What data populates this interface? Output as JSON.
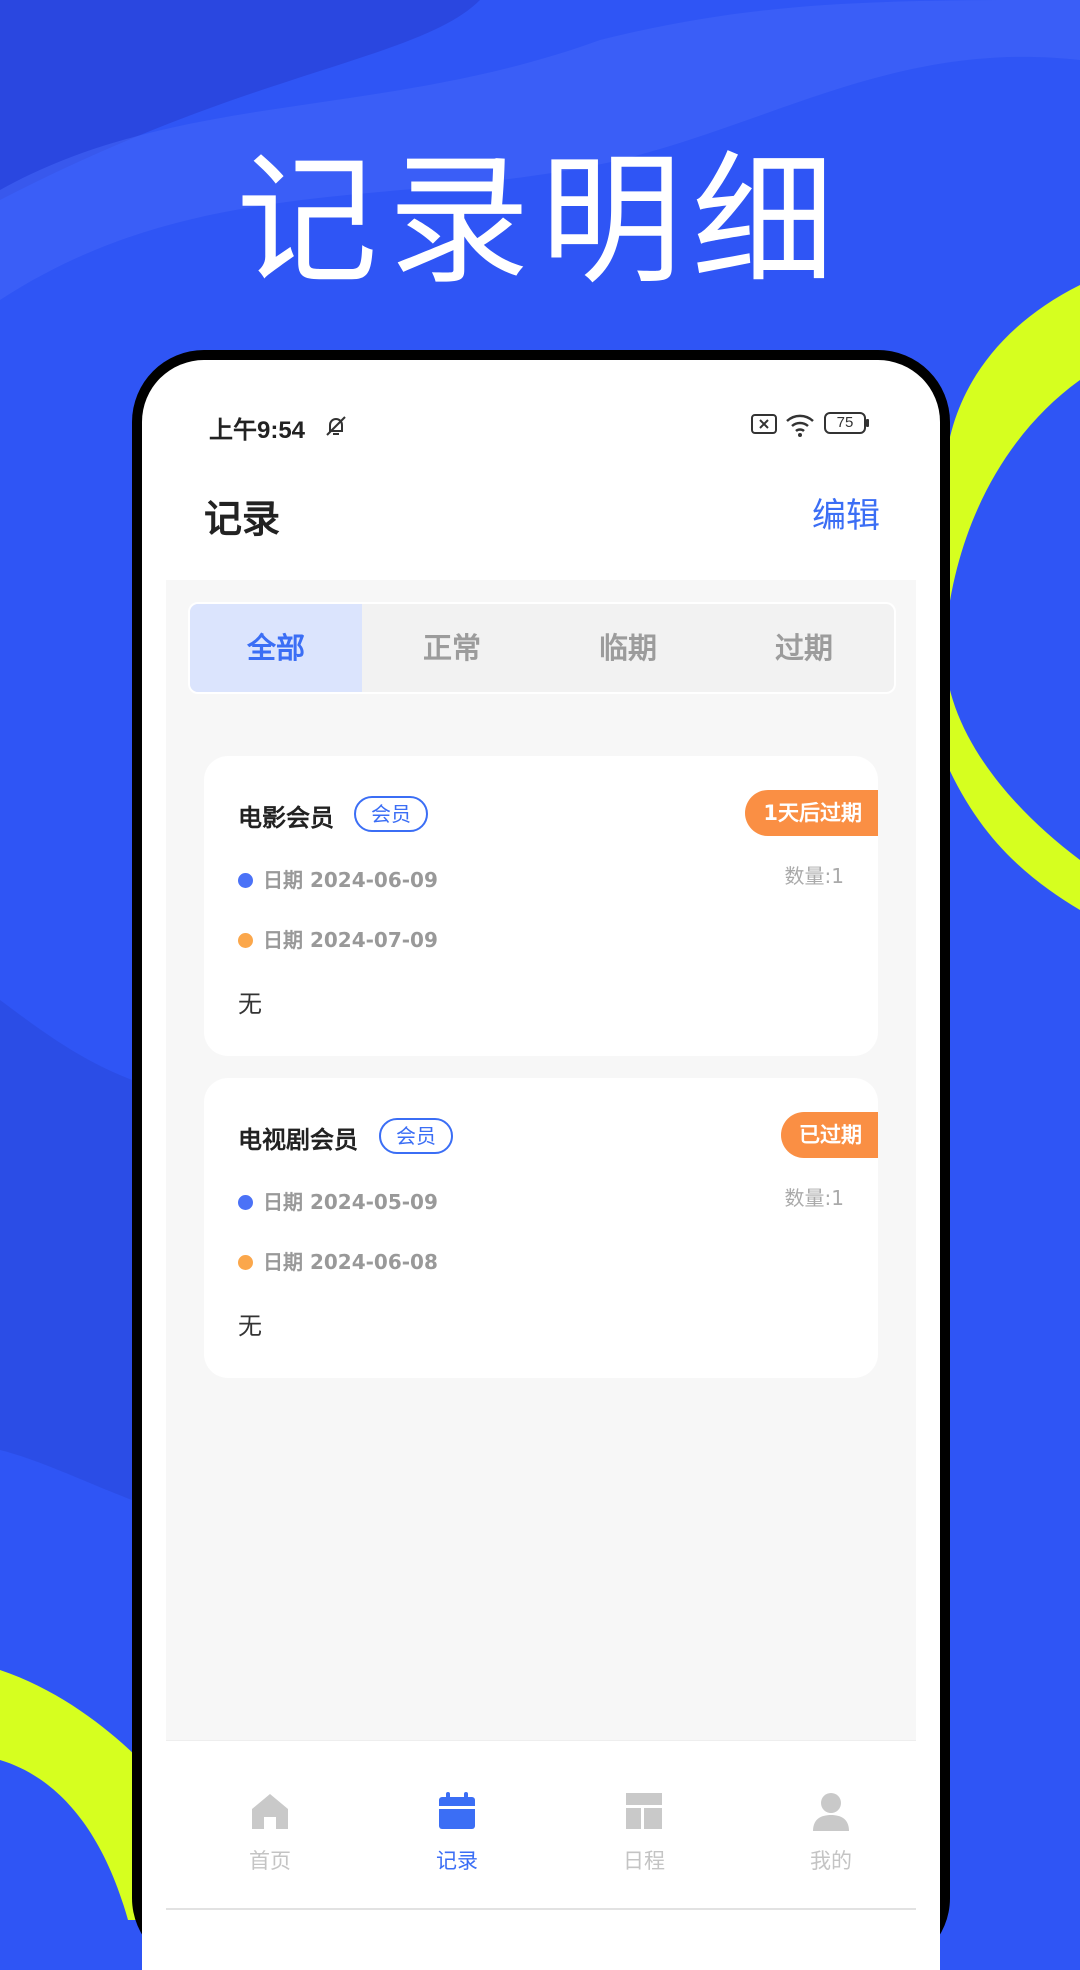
{
  "hero": {
    "title": "记录明细"
  },
  "status_bar": {
    "time": "上午9:54",
    "battery": "75"
  },
  "header": {
    "title": "记录",
    "edit_label": "编辑"
  },
  "tabs": [
    {
      "label": "全部",
      "active": true
    },
    {
      "label": "正常",
      "active": false
    },
    {
      "label": "临期",
      "active": false
    },
    {
      "label": "过期",
      "active": false
    }
  ],
  "records": [
    {
      "title": "电影会员",
      "tag": "会员",
      "badge": "1天后过期",
      "quantity": "数量:1",
      "start_date": "日期 2024-06-09",
      "end_date": "日期 2024-07-09",
      "note": "无"
    },
    {
      "title": "电视剧会员",
      "tag": "会员",
      "badge": "已过期",
      "quantity": "数量:1",
      "start_date": "日期 2024-05-09",
      "end_date": "日期 2024-06-08",
      "note": "无"
    }
  ],
  "bottom_nav": [
    {
      "label": "首页",
      "icon": "home-icon",
      "active": false
    },
    {
      "label": "记录",
      "icon": "calendar-icon",
      "active": true
    },
    {
      "label": "日程",
      "icon": "dashboard-icon",
      "active": false
    },
    {
      "label": "我的",
      "icon": "user-icon",
      "active": false
    }
  ],
  "colors": {
    "background": "#2f55f5",
    "accent": "#3b6ef5",
    "lime": "#d6ff1f",
    "badge_orange": "#fa8f44",
    "dot_blue": "#4b72f7",
    "dot_orange": "#fba74b"
  }
}
